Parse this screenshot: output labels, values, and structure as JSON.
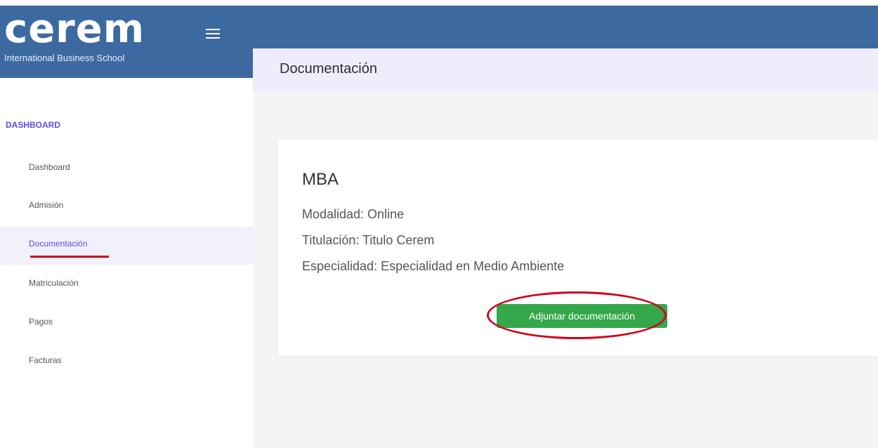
{
  "brand": {
    "logo": "cerem",
    "tagline": "International Business School"
  },
  "header": {
    "title": "Documentación"
  },
  "sidebar": {
    "section_title": "DASHBOARD",
    "items": [
      {
        "label": "Dashboard"
      },
      {
        "label": "Admisión"
      },
      {
        "label": "Documentación"
      },
      {
        "label": "Matriculación"
      },
      {
        "label": "Pagos"
      },
      {
        "label": "Facturas"
      }
    ],
    "active_item": "Documentación"
  },
  "card": {
    "course": "MBA",
    "modalidad": "Modalidad: Online",
    "titulacion": "Titulación: Titulo Cerem",
    "especialidad": "Especialidad: Especialidad en Medio Ambiente",
    "button_label": "Adjuntar documentación"
  },
  "colors": {
    "brand_blue": "#3c6aa0",
    "accent_purple": "#5b4fd9",
    "button_green": "#34a84a",
    "highlight_red": "#d0021b"
  },
  "icons": {
    "menu": "hamburger-menu-icon"
  }
}
